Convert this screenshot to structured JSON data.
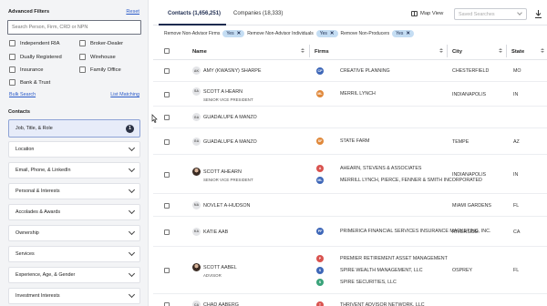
{
  "filters": {
    "header": "Advanced Filters",
    "reset": "Reset",
    "search_placeholder": "Search Person, Firm, CRD or NPN",
    "checkboxes": [
      "Independent RIA",
      "Broker-Dealer",
      "Dually Registered",
      "Wirehouse",
      "Insurance",
      "Family Office",
      "Bank & Trust"
    ],
    "bulk_search": "Bulk Search",
    "list_matching": "List Matching",
    "contacts_header": "Contacts",
    "job_title_role": "Job, Title, & Role",
    "job_count": "1",
    "accordions": [
      "Location",
      "Email, Phone, & LinkedIn",
      "Personal & Interests",
      "Accolades & Awards",
      "Ownership",
      "Services",
      "Experience, Age, & Gender",
      "Investment Interests"
    ]
  },
  "tabs": {
    "contacts": "Contacts (1,656,251)",
    "companies": "Companies (18,333)"
  },
  "toolbar": {
    "map_view": "Map View",
    "saved_searches": "Saved Searches"
  },
  "chips": {
    "label1": "Remove Non-Advisor Firms",
    "label2": "Remove Non-Advisor Individuals",
    "label3": "Remove Non-Producers",
    "value": "Yes"
  },
  "table": {
    "columns": [
      "Name",
      "Firms",
      "City",
      "State"
    ],
    "rows": [
      {
        "initials": "AK",
        "name": "AMY (KWASNY) SHARPE",
        "title": "",
        "firms": [
          "CREATIVE PLANNING"
        ],
        "firm_badges": [
          "CP"
        ],
        "firm_colors": [
          "#3e67b8"
        ],
        "city": "CHESTERFIELD",
        "state": "MO"
      },
      {
        "initials": "SA",
        "name": "SCOTT A HEARN",
        "title": "SENIOR VICE PRESIDENT",
        "firms": [
          "MERRIL LYNCH"
        ],
        "firm_badges": [
          "ML"
        ],
        "firm_colors": [
          "#e0883a"
        ],
        "city": "INDIANAPOLIS",
        "state": "IN"
      },
      {
        "initials": "GA",
        "name": "GUADALUPE A MANZO",
        "title": "",
        "firms": [],
        "firm_badges": [],
        "firm_colors": [],
        "city": "",
        "state": ""
      },
      {
        "initials": "GA",
        "name": "GUADALUPE A MANZO",
        "title": "",
        "firms": [
          "STATE FARM"
        ],
        "firm_badges": [
          "SF"
        ],
        "firm_colors": [
          "#e0883a"
        ],
        "city": "TEMPE",
        "state": "AZ"
      },
      {
        "initials": "",
        "name": "SCOTT AHEARN",
        "title": "SENIOR VICE PRESIDENT",
        "firms": [
          "AHEARN, STEVENS & ASSOCIATES",
          "MERRILL LYNCH, PIERCE, FENNER & SMITH INCORPORATED"
        ],
        "firm_badges": [
          "A",
          "ML"
        ],
        "firm_colors": [
          "#d9534f",
          "#3e67b8"
        ],
        "city": "INDIANAPOLIS",
        "state": "IN"
      },
      {
        "initials": "NA",
        "name": "NOVLET A-HUDSON",
        "title": "",
        "firms": [],
        "firm_badges": [],
        "firm_colors": [],
        "city": "MIAMI GARDENS",
        "state": "FL"
      },
      {
        "initials": "KA",
        "name": "KATIE AAB",
        "title": "",
        "firms": [
          "PRIMERICA FINANCIAL SERVICES INSURANCE MARKETING, INC."
        ],
        "firm_badges": [
          "PF"
        ],
        "firm_colors": [
          "#3e67b8"
        ],
        "city": "RIVERSIDE",
        "state": "CA"
      },
      {
        "initials": "",
        "name": "SCOTT AABEL",
        "title": "ADVISOR",
        "firms": [
          "PREMIER RETIREMENT ASSET MANAGEMENT",
          "SPIRE WEALTH MANAGEMENT, LLC",
          "SPIRE SECURITIES, LLC"
        ],
        "firm_badges": [
          "P",
          "S",
          "S"
        ],
        "firm_colors": [
          "#d9534f",
          "#3e67b8",
          "#3aa37a"
        ],
        "city": "OSPREY",
        "state": "FL"
      },
      {
        "initials": "CA",
        "name": "CHAD AABERG",
        "title": "",
        "firms": [
          "THRIVENT ADVISOR NETWORK, LLC"
        ],
        "firm_badges": [
          "T"
        ],
        "firm_colors": [
          "#d9534f"
        ],
        "city": "",
        "state": ""
      }
    ]
  }
}
